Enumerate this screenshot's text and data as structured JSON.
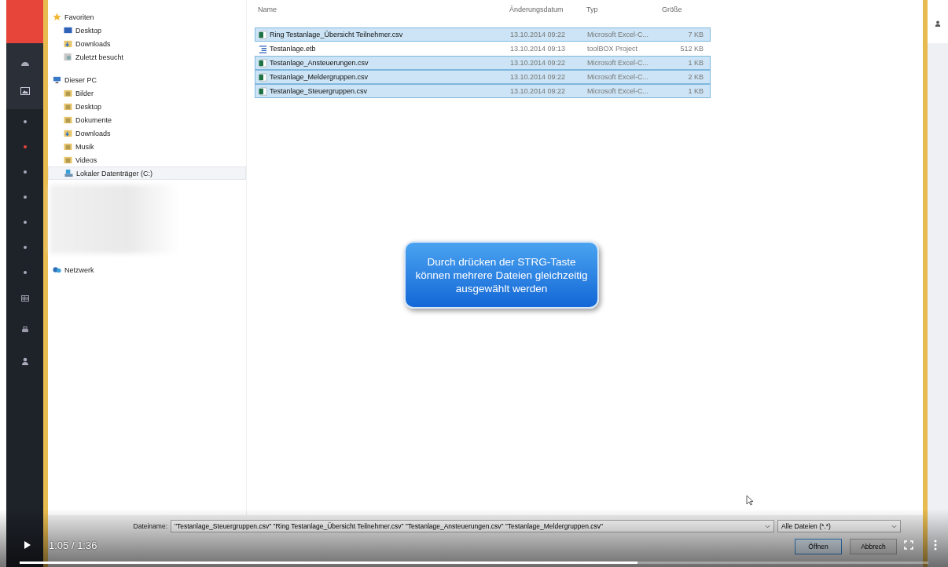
{
  "sidebar": {
    "dots": [
      {
        "selected": false
      },
      {
        "selected": true
      },
      {
        "selected": false
      },
      {
        "selected": false
      },
      {
        "selected": false
      },
      {
        "selected": false
      },
      {
        "selected": false
      }
    ]
  },
  "navigation": [
    {
      "label": "Favoriten",
      "kind": "star",
      "children": [
        {
          "label": "Desktop",
          "kind": "desktop",
          "selected": false
        },
        {
          "label": "Downloads",
          "kind": "download",
          "selected": false
        },
        {
          "label": "Zuletzt besucht",
          "kind": "recent",
          "selected": false
        }
      ]
    },
    {
      "label": "Dieser PC",
      "kind": "pc",
      "children": [
        {
          "label": "Bilder",
          "kind": "folder",
          "selected": false
        },
        {
          "label": "Desktop",
          "kind": "folder",
          "selected": false
        },
        {
          "label": "Dokumente",
          "kind": "folder",
          "selected": false
        },
        {
          "label": "Downloads",
          "kind": "download",
          "selected": false
        },
        {
          "label": "Musik",
          "kind": "folder",
          "selected": false
        },
        {
          "label": "Videos",
          "kind": "folder",
          "selected": false
        },
        {
          "label": "Lokaler Datenträger (C:)",
          "kind": "drive",
          "selected": true
        }
      ]
    },
    {
      "label": "Netzwerk",
      "kind": "network"
    }
  ],
  "file_list": {
    "columns": [
      "Name",
      "Änderungsdatum",
      "Typ",
      "Größe"
    ],
    "rows": [
      {
        "name": "Ring Testanlage_Übersicht Teilnehmer.csv",
        "date": "13.10.2014 09:22",
        "type": "Microsoft Excel-C...",
        "size": "7 KB",
        "kind": "csv",
        "selected": true
      },
      {
        "name": "Testanlage.etb",
        "date": "13.10.2014 09:13",
        "type": "toolBOX Project",
        "size": "512 KB",
        "kind": "etb",
        "selected": false
      },
      {
        "name": "Testanlage_Ansteuerungen.csv",
        "date": "13.10.2014 09:22",
        "type": "Microsoft Excel-C...",
        "size": "1 KB",
        "kind": "csv",
        "selected": true
      },
      {
        "name": "Testanlage_Meldergruppen.csv",
        "date": "13.10.2014 09:22",
        "type": "Microsoft Excel-C...",
        "size": "2 KB",
        "kind": "csv",
        "selected": true
      },
      {
        "name": "Testanlage_Steuergruppen.csv",
        "date": "13.10.2014 09:22",
        "type": "Microsoft Excel-C...",
        "size": "1 KB",
        "kind": "csv",
        "selected": true
      }
    ]
  },
  "callout": "Durch drücken der STRG-Taste können mehrere Dateien gleichzeitig ausgewählt werden",
  "filename": {
    "label": "Dateiname:",
    "value": "\"Testanlage_Steuergruppen.csv\" \"Ring Testanlage_Übersicht Teilnehmer.csv\" \"Testanlage_Ansteuerungen.csv\" \"Testanlage_Meldergruppen.csv\""
  },
  "file_filter": "Alle Dateien (*.*)",
  "buttons": [
    "Öffnen",
    "Abbrech"
  ],
  "video": {
    "time": "1:05 / 1:36",
    "level": 0.68
  }
}
